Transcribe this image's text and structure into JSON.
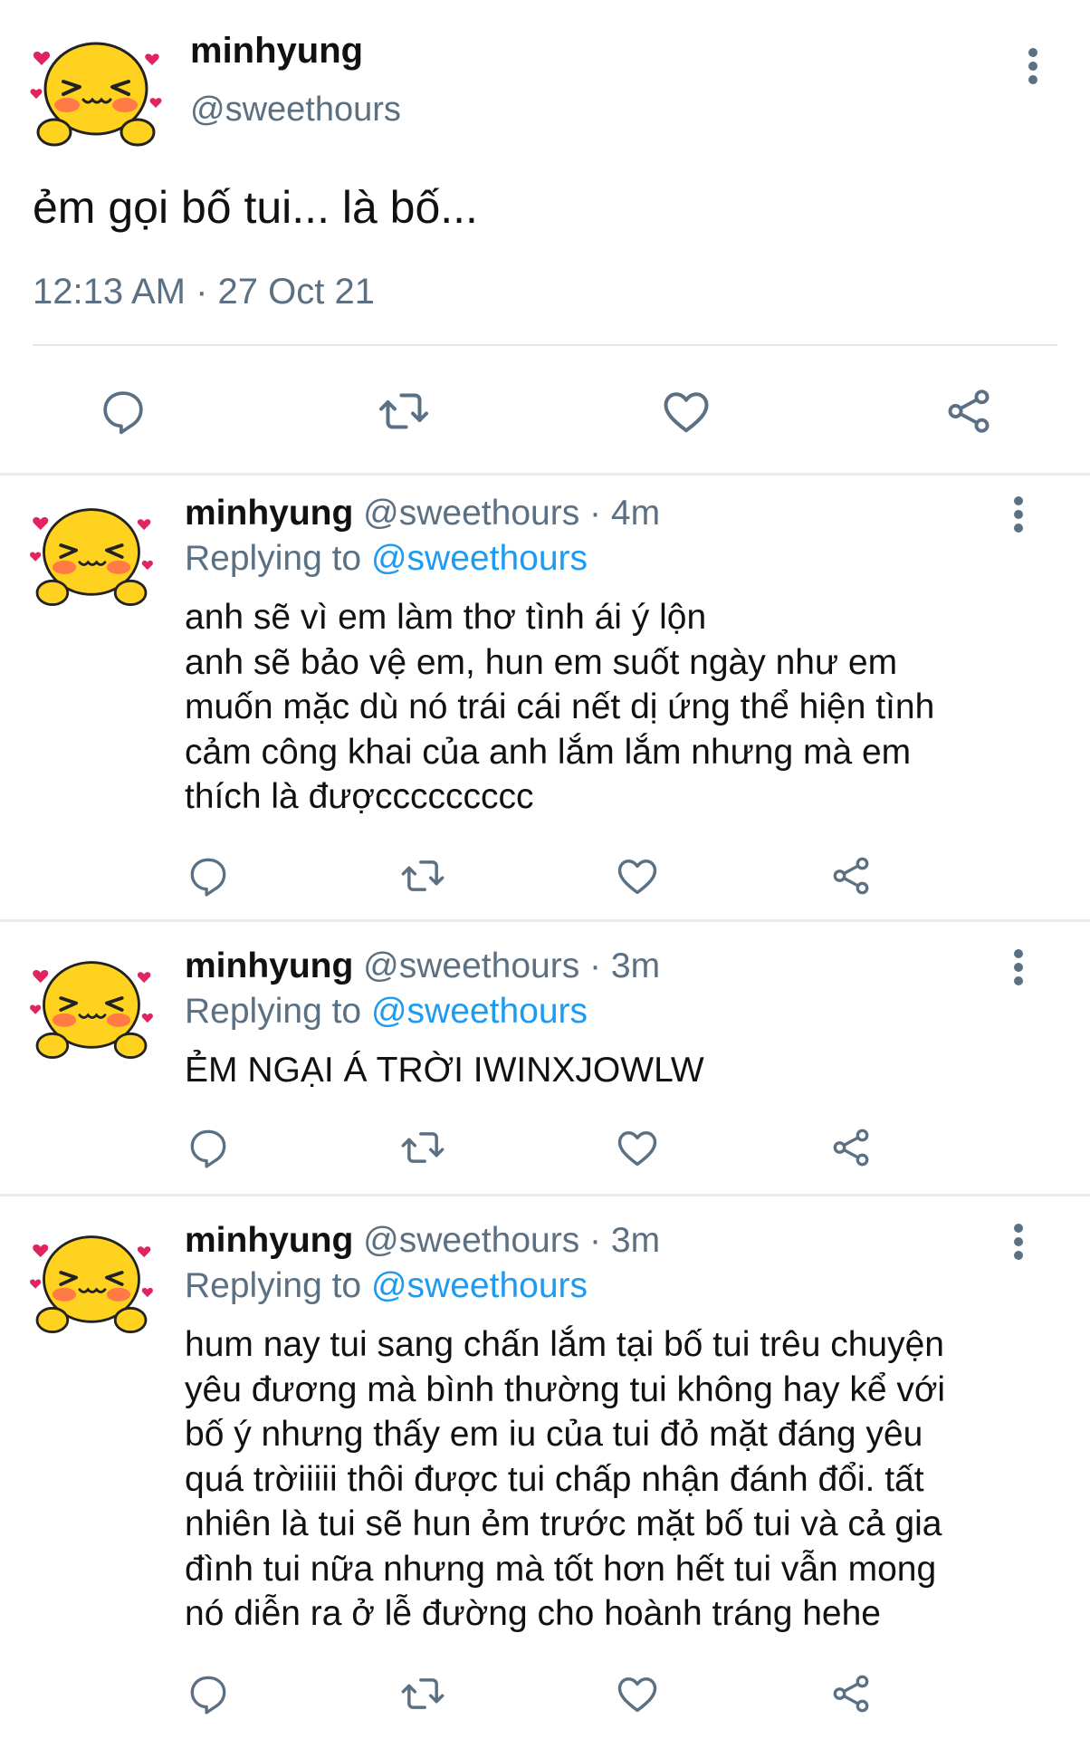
{
  "main_tweet": {
    "name": "minhyung",
    "handle": "@sweethours",
    "text": "ẻm gọi bố tui... là bố...",
    "timestamp": "12:13 AM · 27 Oct 21",
    "actions": [
      "reply-icon",
      "retweet-icon",
      "like-icon",
      "share-icon"
    ]
  },
  "replies": [
    {
      "name": "minhyung",
      "handle": "@sweethours",
      "dot": "·",
      "time": "4m",
      "replying_label": "Replying to",
      "replying_to": "@sweethours",
      "lines": [
        "anh sẽ vì em làm thơ tình ái ý lộn",
        "anh sẽ bảo vệ em, hun em suốt ngày như em",
        "muốn mặc dù nó trái cái nết dị ứng thể hiện tình",
        "cảm công khai của anh lắm lắm nhưng mà em",
        "thích là đượccccccccc"
      ]
    },
    {
      "name": "minhyung",
      "handle": "@sweethours",
      "dot": "·",
      "time": "3m",
      "replying_label": "Replying to",
      "replying_to": "@sweethours",
      "lines": [
        "ẺM NGẠI Á TRỜI IWINXJOWLW"
      ]
    },
    {
      "name": "minhyung",
      "handle": "@sweethours",
      "dot": "·",
      "time": "3m",
      "replying_label": "Replying to",
      "replying_to": "@sweethours",
      "lines": [
        "hum nay tui sang chấn lắm tại bố tui trêu chuyện",
        "yêu đương mà bình thường tui không hay kể với",
        "bố ý nhưng thấy em iu của tui đỏ mặt đáng yêu",
        "quá trờiiiii thôi được tui chấp nhận đánh đổi. tất",
        "nhiên là tui sẽ hun ẻm trước mặt bố tui và cả gia",
        "đình tui nữa nhưng mà tốt hơn hết tui vẫn mong",
        "nó diễn ra ở lễ đường cho hoành tráng hehe"
      ]
    }
  ],
  "colors": {
    "text": "#111111",
    "secondary": "#5b7083",
    "link": "#1d9bf0",
    "icon": "#5b7083",
    "divider": "#e6ecf0",
    "avatar_face": "#ffd21f",
    "avatar_blush": "#ff7a45",
    "avatar_heart": "#e0245e"
  }
}
